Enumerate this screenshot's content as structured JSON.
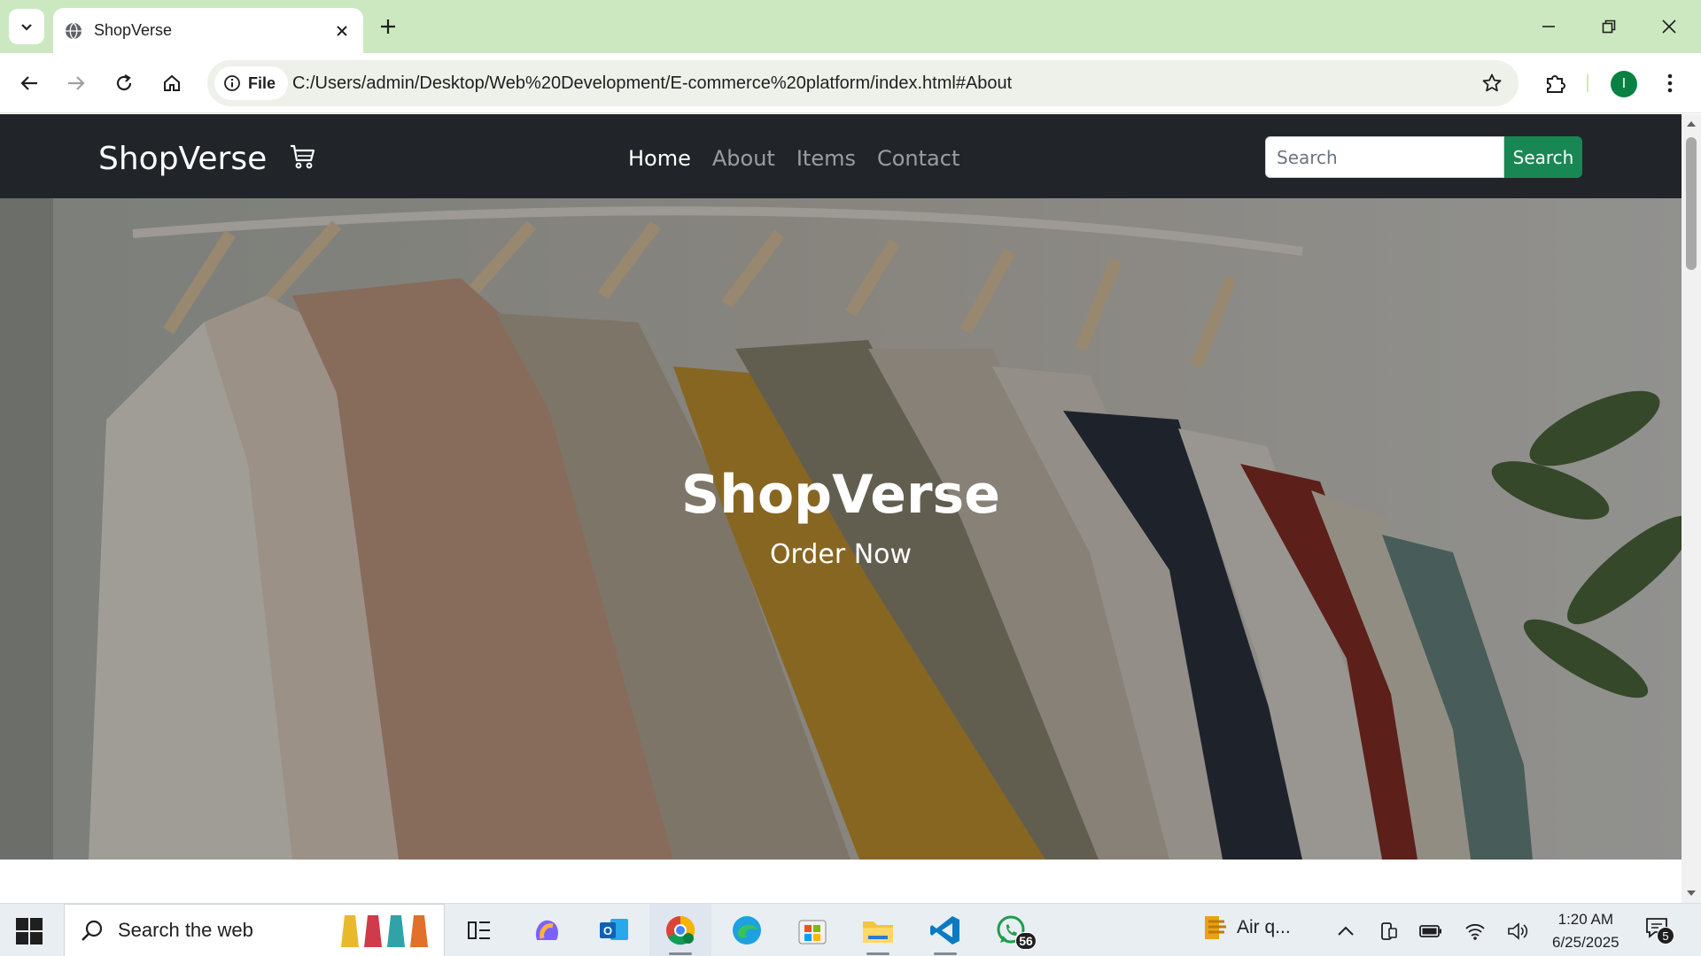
{
  "browser": {
    "tab": {
      "title": "ShopVerse"
    },
    "address": {
      "chip_label": "File",
      "url": "C:/Users/admin/Desktop/Web%20Development/E-commerce%20platform/index.html#About"
    },
    "profile_initial": "I",
    "colors": {
      "frame": "#cce8c1",
      "avatar": "#0b8043"
    }
  },
  "site": {
    "brand": "ShopVerse",
    "nav": [
      {
        "label": "Home",
        "active": true
      },
      {
        "label": "About",
        "active": false
      },
      {
        "label": "Items",
        "active": false
      },
      {
        "label": "Contact",
        "active": false
      }
    ],
    "search": {
      "placeholder": "Search",
      "button_label": "Search"
    },
    "hero": {
      "title": "ShopVerse",
      "subtitle": "Order Now"
    },
    "colors": {
      "navbar": "#212529",
      "search_button": "#198754"
    }
  },
  "taskbar": {
    "search_label": "Search the web",
    "whatsapp_badge": "56",
    "weather_label": "Air q...",
    "time": "1:20 AM",
    "date": "6/25/2025",
    "notification_count": "5"
  }
}
